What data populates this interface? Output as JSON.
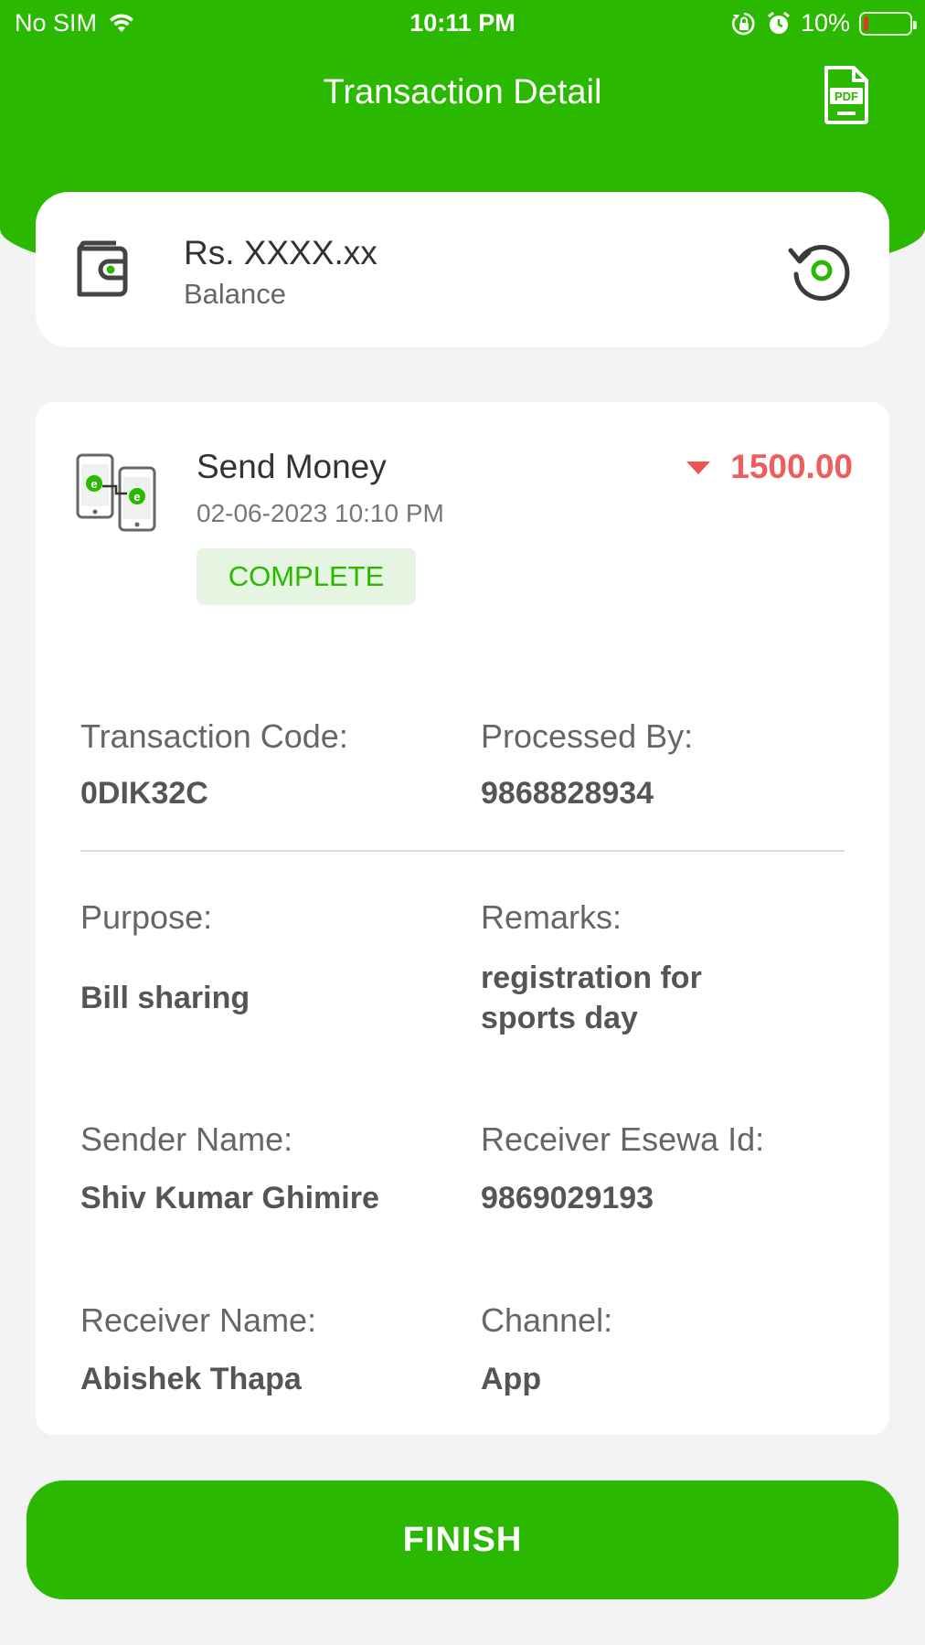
{
  "status_bar": {
    "carrier": "No SIM",
    "time": "10:11 PM",
    "battery_percent": "10%",
    "battery_level": 0.1,
    "icons": [
      "wifi-icon",
      "orientation-lock-icon",
      "alarm-icon",
      "battery-icon"
    ]
  },
  "header": {
    "title": "Transaction Detail",
    "pdf_icon_text": "PDF",
    "background": "#2bb800"
  },
  "balance": {
    "amount": "Rs. XXXX.xx",
    "label": "Balance",
    "icons": [
      "wallet-icon",
      "refresh-icon"
    ]
  },
  "transaction": {
    "type": "Send Money",
    "date": "02-06-2023 10:10 PM",
    "status": "COMPLETE",
    "amount": "1500.00",
    "amount_color": "#ef5d5d",
    "icons": [
      "send-money-icon",
      "debit-arrow-icon"
    ]
  },
  "fields": {
    "transaction_code_label": "Transaction Code:",
    "transaction_code": "0DIK32C",
    "processed_by_label": "Processed By:",
    "processed_by": "9868828934",
    "purpose_label": "Purpose:",
    "purpose": "Bill sharing",
    "remarks_label": "Remarks:",
    "remarks_line1": "registration for",
    "remarks_line2": "sports day",
    "sender_name_label": "Sender Name:",
    "sender_name": "Shiv Kumar Ghimire",
    "receiver_esewa_label": "Receiver Esewa Id:",
    "receiver_esewa": "9869029193",
    "receiver_name_label": "Receiver Name:",
    "receiver_name": "Abishek Thapa",
    "channel_label": "Channel:",
    "channel": "App"
  },
  "footer": {
    "finish_label": "FINISH",
    "accent": "#2bb800"
  }
}
